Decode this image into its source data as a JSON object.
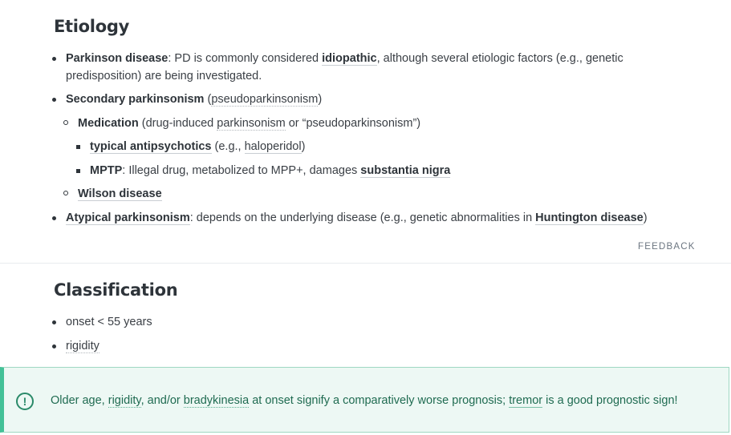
{
  "etiology": {
    "title": "Etiology",
    "pd_term": "Parkinson disease",
    "pd_text1": ": PD is commonly considered ",
    "pd_idiopathic": "idiopathic",
    "pd_text2": ", although several etiologic factors (e.g., genetic",
    "pd_text3": "predisposition) are being investigated.",
    "secondary_term": "Secondary parkinsonism",
    "secondary_text1": " (",
    "secondary_link": "pseudoparkinsonism",
    "secondary_text2": ")",
    "medication_term": "Medication",
    "medication_text1": " (drug-induced ",
    "medication_link": "parkinsonism",
    "medication_text2": " or “pseudoparkinsonism”)",
    "antipsychotics_term": "typical antipsychotics",
    "antipsychotics_text1": " (e.g., ",
    "antipsychotics_link": "haloperidol",
    "antipsychotics_text2": ")",
    "mptp_term": "MPTP",
    "mptp_text": ": Illegal drug, metabolized to MPP+, damages ",
    "mptp_link": "substantia nigra",
    "wilson_term": "Wilson disease",
    "atypical_term": "Atypical parkinsonism",
    "atypical_text1": ": depends on the underlying disease (e.g., genetic abnormalities in ",
    "atypical_link": "Huntington disease",
    "atypical_text2": ")",
    "feedback_label": "FEEDBACK"
  },
  "classification": {
    "title": "Classification",
    "items": [
      "onset < 55 years",
      "rigidity"
    ]
  },
  "callout": {
    "icon": "!",
    "text1": "Older age, ",
    "rigidity": "rigidity",
    "text2": ", and/or ",
    "bradykinesia": "bradykinesia",
    "text3": " at onset signify a comparatively worse prognosis; ",
    "tremor": "tremor",
    "text4": " is a good prognostic sign!"
  }
}
